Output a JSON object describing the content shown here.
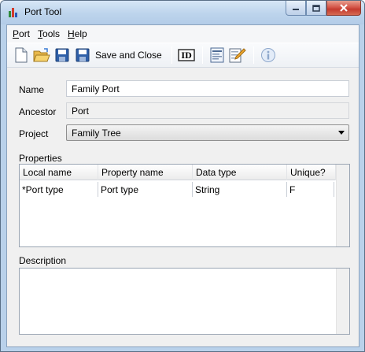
{
  "window": {
    "title": "Port Tool"
  },
  "menu": [
    {
      "key": "P",
      "rest": "ort"
    },
    {
      "key": "T",
      "rest": "ools"
    },
    {
      "key": "H",
      "rest": "elp"
    }
  ],
  "toolbar": {
    "save_close_label": "Save and Close",
    "buttons": [
      "new-document-icon",
      "open-folder-icon",
      "save-icon",
      "save-and-close-icon",
      "id-icon",
      "properties-icon",
      "edit-icon",
      "info-icon"
    ]
  },
  "form": {
    "name_label": "Name",
    "name_value": "Family Port",
    "ancestor_label": "Ancestor",
    "ancestor_value": "Port",
    "project_label": "Project",
    "project_value": "Family Tree"
  },
  "properties": {
    "section_label": "Properties",
    "columns": [
      "Local name",
      "Property name",
      "Data type",
      "Unique?"
    ],
    "rows": [
      [
        "*Port type",
        "Port type",
        "String",
        "F"
      ]
    ]
  },
  "description": {
    "section_label": "Description",
    "value": ""
  },
  "colors": {
    "titlebar": "#bdd4ec",
    "close_button": "#c43b2f",
    "client_bg": "#f0f0f0"
  }
}
